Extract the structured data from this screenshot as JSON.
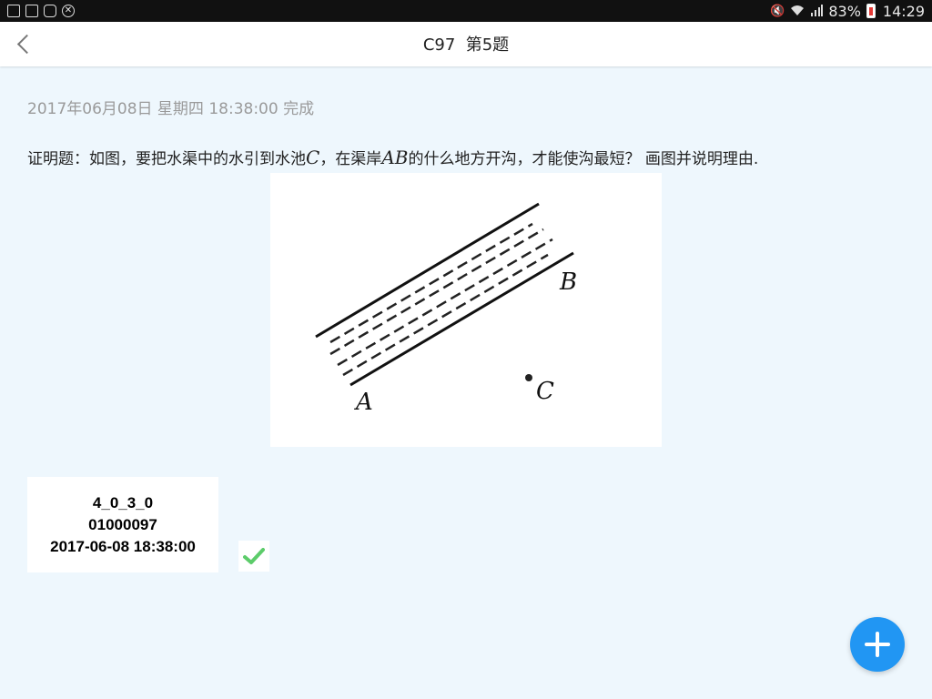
{
  "status_bar": {
    "battery": "83%",
    "time": "14:29",
    "icons": [
      "app-icon",
      "app-icon",
      "app-icon",
      "blocked-icon",
      "mute-icon",
      "wifi-icon",
      "signal-icon",
      "battery-icon"
    ]
  },
  "header": {
    "title": "C97  第5题",
    "back_icon": "chevron-left-icon"
  },
  "record": {
    "timestamp": "2017年06月08日 星期四 18:38:00 完成"
  },
  "question": {
    "text_part1": "证明题：如图，要把水渠中的水引到水池",
    "point_c": "C",
    "text_part2": "，在渠岸",
    "segment_ab": "AB",
    "text_part3": "的什么地方开沟，才能使沟最短？ 画图并说明理由."
  },
  "figure": {
    "label_a": "A",
    "label_b": "B",
    "label_c": "C"
  },
  "card": {
    "line1": "4_0_3_0",
    "line2": "01000097",
    "line3": "2017-06-08 18:38:00"
  },
  "status": {
    "check_color": "#5ccc6a"
  },
  "fab": {
    "icon": "plus-icon",
    "color": "#2196f3"
  }
}
